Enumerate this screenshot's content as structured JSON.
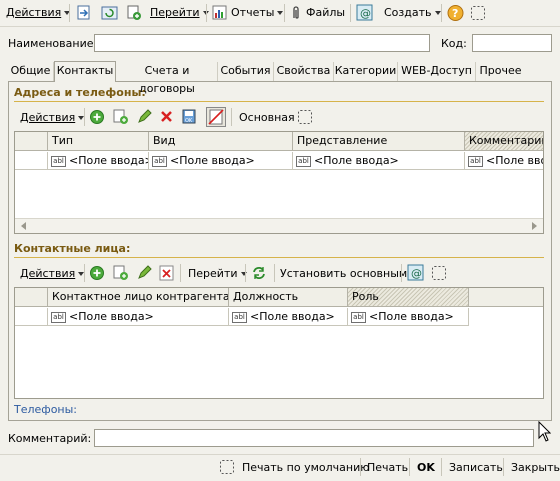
{
  "toolbar": {
    "actions": "Действия",
    "goto": "Перейти",
    "reports": "Отчеты",
    "files": "Файлы",
    "create": "Создать"
  },
  "form": {
    "name_label": "Наименование:",
    "name_value": "",
    "code_label": "Код:",
    "code_value": ""
  },
  "tabs": [
    "Общие",
    "Контакты",
    "Счета и договоры",
    "События",
    "Свойства",
    "Категории",
    "WEB-Доступ",
    "Прочее"
  ],
  "addresses": {
    "title": "Адреса и телефоны:",
    "actions": "Действия",
    "main": "Основная",
    "columns": [
      "Тип",
      "Вид",
      "Представление",
      "Комментарии"
    ],
    "row": [
      "<Поле ввода>",
      "<Поле ввода>",
      "<Поле ввода>",
      "<Поле ввода>"
    ]
  },
  "contacts": {
    "title": "Контактные лица:",
    "actions": "Действия",
    "goto": "Перейти",
    "set_main": "Установить основным",
    "columns": [
      "Контактное лицо контрагента",
      "Должность",
      "Роль"
    ],
    "row": [
      "<Поле ввода>",
      "<Поле ввода>",
      "<Поле ввода>"
    ]
  },
  "phones_label": "Телефоны:",
  "comment_label": "Комментарий:",
  "comment_value": "",
  "bottom": {
    "print_default": "Печать по умолчанию",
    "print": "Печать",
    "ok": "OK",
    "save": "Записать",
    "close": "Закрыть"
  }
}
